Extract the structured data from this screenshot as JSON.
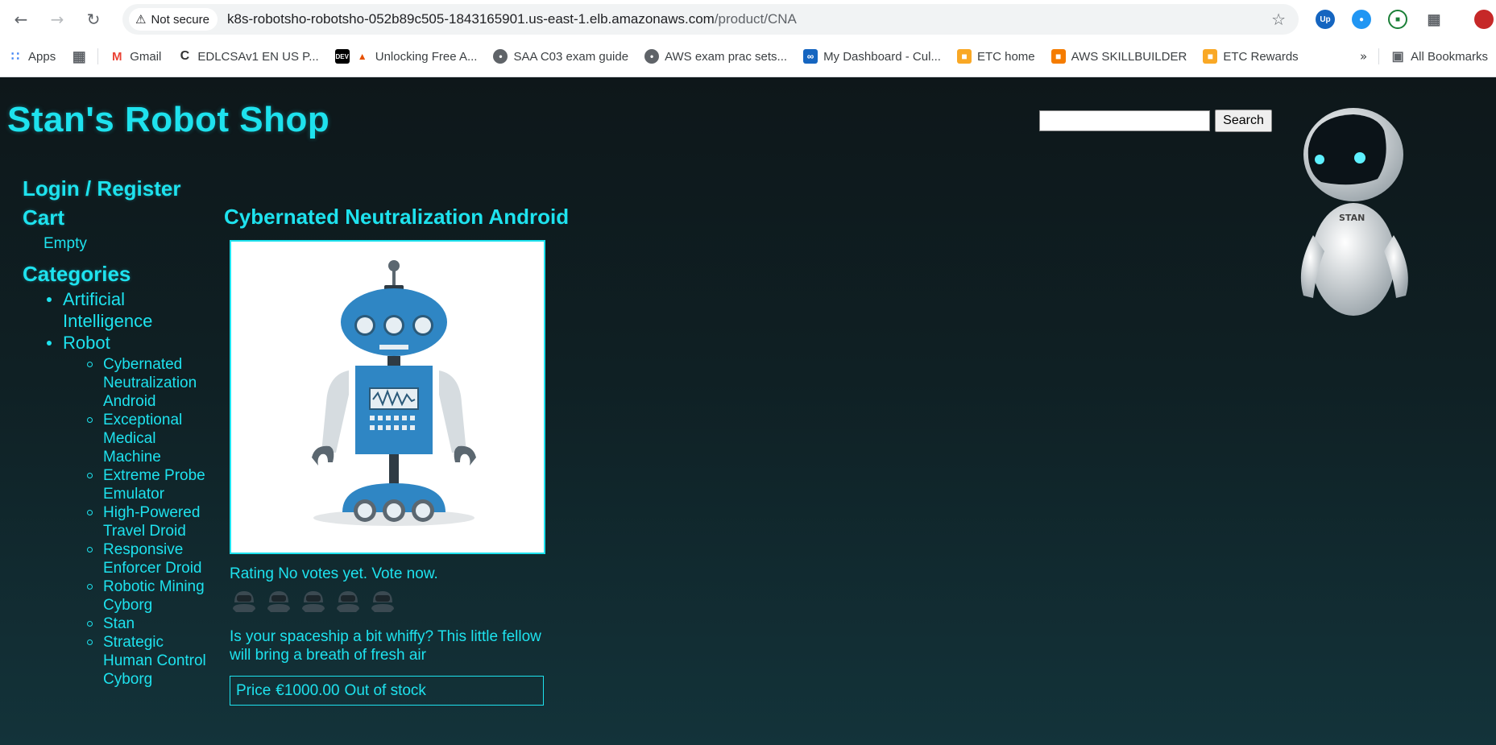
{
  "browser": {
    "security_label": "Not secure",
    "url_host": "k8s-robotsho-robotsho-052b89c505-1843165901.us-east-1.elb.amazonaws.com",
    "url_path": "/product/CNA",
    "bookmarks": [
      {
        "label": "Apps",
        "icon": "apps-grid-icon"
      },
      {
        "label": "Gmail",
        "icon": "gmail-icon"
      },
      {
        "label": "EDLCSAv1 EN US P...",
        "icon": "course-icon"
      },
      {
        "label": "Unlocking Free A...",
        "icon": "dev-icon"
      },
      {
        "label": "SAA C03 exam guide",
        "icon": "globe-icon"
      },
      {
        "label": "AWS exam prac sets...",
        "icon": "globe-icon"
      },
      {
        "label": "My Dashboard - Cul...",
        "icon": "dashboard-icon"
      },
      {
        "label": "ETC home",
        "icon": "etc-icon"
      },
      {
        "label": "AWS SKILLBUILDER",
        "icon": "aws-icon"
      },
      {
        "label": "ETC Rewards",
        "icon": "etc-icon"
      }
    ],
    "all_bookmarks_label": "All Bookmarks"
  },
  "site": {
    "title": "Stan's Robot Shop",
    "search_button": "Search",
    "search_value": ""
  },
  "sidebar": {
    "login": "Login / Register",
    "cart_heading": "Cart",
    "cart_status": "Empty",
    "categories_heading": "Categories",
    "categories": [
      {
        "label": "Artificial Intelligence",
        "items": []
      },
      {
        "label": "Robot",
        "items": [
          "Cybernated Neutralization Android",
          "Exceptional Medical Machine",
          "Extreme Probe Emulator",
          "High-Powered Travel Droid",
          "Responsive Enforcer Droid",
          "Robotic Mining Cyborg",
          "Stan",
          "Strategic Human Control Cyborg"
        ]
      }
    ]
  },
  "product": {
    "name": "Cybernated Neutralization Android",
    "rating_label": "Rating",
    "rating_text": "No votes yet. Vote now.",
    "rating_value": 0,
    "rating_max": 5,
    "description": "Is your spaceship a bit whiffy? This little fellow will bring a breath of fresh air",
    "price_label": "Price",
    "price": "€1000.00",
    "stock": "Out of stock"
  },
  "colors": {
    "accent": "#1ee2ee",
    "page_bg": "#0f2024"
  }
}
